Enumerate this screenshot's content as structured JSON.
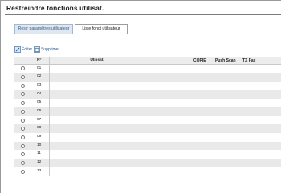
{
  "title": "Restreindre fonctions utilisat.",
  "tabs": [
    {
      "label": "Restr paramètres utilisateur",
      "active": false
    },
    {
      "label": "Liste fonct utilisateur",
      "active": true
    }
  ],
  "toolbar": {
    "edit_label": "Éditer",
    "delete_label": "Supprimer",
    "edit_icon": "edit-icon",
    "delete_icon": "delete-icon"
  },
  "table": {
    "headers": {
      "num": "N°",
      "user": "Utilisat.",
      "copy": "COPIE",
      "push_scan": "Push Scan",
      "tx_fax": "TX Fax"
    },
    "rows": [
      {
        "num": "01"
      },
      {
        "num": "02"
      },
      {
        "num": "03"
      },
      {
        "num": "04"
      },
      {
        "num": "05"
      },
      {
        "num": "06"
      },
      {
        "num": "07"
      },
      {
        "num": "08"
      },
      {
        "num": "09"
      },
      {
        "num": "10"
      },
      {
        "num": "11"
      },
      {
        "num": "12"
      },
      {
        "num": "13"
      }
    ]
  },
  "colors": {
    "tab_inactive_bg": "#e0e7f0",
    "link_text": "#2b5a88",
    "row_shade": "#e9e9e9"
  }
}
